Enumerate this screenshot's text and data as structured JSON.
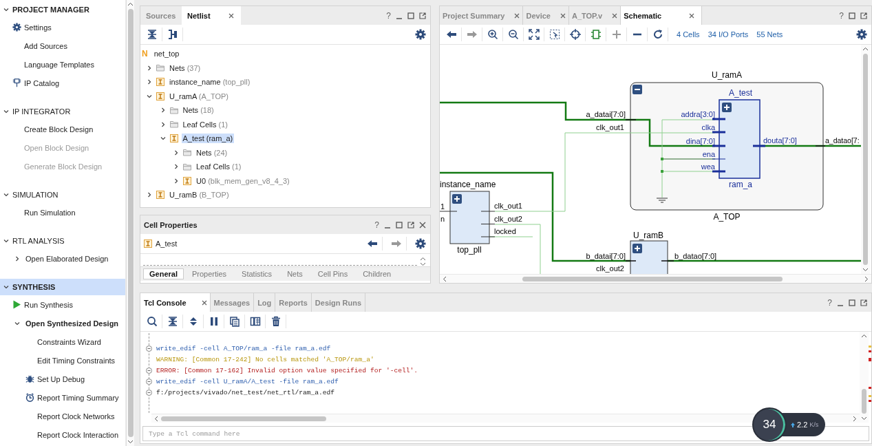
{
  "flow_navigator": {
    "sections": [
      {
        "title": "PROJECT MANAGER",
        "expanded": true,
        "selected": false,
        "active": true,
        "items": [
          {
            "label": "Settings",
            "kind": "settings",
            "disabled": false
          },
          {
            "label": "Add Sources",
            "kind": "plain",
            "disabled": false
          },
          {
            "label": "Language Templates",
            "kind": "plain",
            "disabled": false
          },
          {
            "label": "IP Catalog",
            "kind": "ip",
            "disabled": false
          }
        ]
      },
      {
        "title": "IP INTEGRATOR",
        "expanded": true,
        "selected": false,
        "active": false,
        "items": [
          {
            "label": "Create Block Design",
            "kind": "plain",
            "disabled": false
          },
          {
            "label": "Open Block Design",
            "kind": "plain",
            "disabled": true
          },
          {
            "label": "Generate Block Design",
            "kind": "plain",
            "disabled": true
          }
        ]
      },
      {
        "title": "SIMULATION",
        "expanded": true,
        "selected": false,
        "active": false,
        "items": [
          {
            "label": "Run Simulation",
            "kind": "plain",
            "disabled": false
          }
        ]
      },
      {
        "title": "RTL ANALYSIS",
        "expanded": true,
        "selected": false,
        "active": false,
        "items": [
          {
            "label": "Open Elaborated Design",
            "kind": "group",
            "disabled": false,
            "expanded": false,
            "active": false
          }
        ]
      },
      {
        "title": "SYNTHESIS",
        "expanded": true,
        "selected": true,
        "active": true,
        "items": [
          {
            "label": "Run Synthesis",
            "kind": "run",
            "disabled": false
          },
          {
            "label": "Open Synthesized Design",
            "kind": "group",
            "disabled": false,
            "expanded": true,
            "active": true,
            "children": [
              {
                "label": "Constraints Wizard",
                "kind": "plain",
                "disabled": false
              },
              {
                "label": "Edit Timing Constraints",
                "kind": "plain",
                "disabled": false
              },
              {
                "label": "Set Up Debug",
                "kind": "debug",
                "disabled": false
              },
              {
                "label": "Report Timing Summary",
                "kind": "timing",
                "disabled": false
              },
              {
                "label": "Report Clock Networks",
                "kind": "plain",
                "disabled": false
              },
              {
                "label": "Report Clock Interaction",
                "kind": "plain",
                "disabled": false
              }
            ]
          }
        ]
      }
    ]
  },
  "netlist_panel": {
    "tabs": [
      {
        "label": "Sources",
        "selected": false,
        "closable": false
      },
      {
        "label": "Netlist",
        "selected": true,
        "closable": true
      }
    ],
    "help": "?",
    "tree": {
      "label": "net_top",
      "badge": "N",
      "children": [
        {
          "label": "Nets",
          "detail": "(37)",
          "kind": "folder",
          "expanded": false,
          "selected": false
        },
        {
          "label": "instance_name",
          "detail": "(top_pll)",
          "kind": "instance",
          "expanded": false,
          "selected": false
        },
        {
          "label": "U_ramA",
          "detail": "(A_TOP)",
          "kind": "instance",
          "expanded": true,
          "selected": false,
          "children": [
            {
              "label": "Nets",
              "detail": "(18)",
              "kind": "folder",
              "expanded": false,
              "selected": false
            },
            {
              "label": "Leaf Cells",
              "detail": "(1)",
              "kind": "folder",
              "expanded": false,
              "selected": false
            },
            {
              "label": "A_test",
              "detail": "(ram_a)",
              "kind": "instance",
              "expanded": true,
              "selected": true,
              "children": [
                {
                  "label": "Nets",
                  "detail": "(24)",
                  "kind": "folder",
                  "expanded": false,
                  "selected": false
                },
                {
                  "label": "Leaf Cells",
                  "detail": "(1)",
                  "kind": "folder",
                  "expanded": false,
                  "selected": false
                },
                {
                  "label": "U0",
                  "detail": "(blk_mem_gen_v8_4_3)",
                  "kind": "instance",
                  "expanded": false,
                  "selected": false
                }
              ]
            }
          ]
        },
        {
          "label": "U_ramB",
          "detail": "(B_TOP)",
          "kind": "instance",
          "expanded": false,
          "selected": false
        }
      ]
    }
  },
  "cell_properties": {
    "title": "Cell Properties",
    "help": "?",
    "object": "A_test",
    "nav": [
      {
        "kind": "back",
        "disabled": false
      },
      {
        "kind": "forward",
        "disabled": true
      }
    ],
    "tabs": [
      {
        "label": "General",
        "selected": true
      },
      {
        "label": "Properties",
        "selected": false
      },
      {
        "label": "Statistics",
        "selected": false
      },
      {
        "label": "Nets",
        "selected": false
      },
      {
        "label": "Cell Pins",
        "selected": false
      },
      {
        "label": "Children",
        "selected": false
      }
    ]
  },
  "editor": {
    "tabs": [
      {
        "label": "Project Summary",
        "selected": false
      },
      {
        "label": "Device",
        "selected": false
      },
      {
        "label": "A_TOP.v",
        "selected": false
      },
      {
        "label": "Schematic",
        "selected": true
      }
    ],
    "help": "?",
    "tools": [
      {
        "kind": "back",
        "disabled": false
      },
      {
        "kind": "forward",
        "disabled": true
      },
      {
        "kind": "zoom_in",
        "disabled": false
      },
      {
        "kind": "zoom_out",
        "disabled": false
      },
      {
        "kind": "fit",
        "disabled": false
      },
      {
        "kind": "zoom_area",
        "disabled": false
      },
      {
        "kind": "center",
        "disabled": false
      },
      {
        "kind": "cell",
        "disabled": false
      },
      {
        "kind": "expand",
        "disabled": true
      },
      {
        "kind": "collapse",
        "disabled": false
      },
      {
        "kind": "refresh",
        "disabled": false
      }
    ],
    "stats": [
      "4 Cells",
      "34 I/O Ports",
      "55 Nets"
    ]
  },
  "schematic": {
    "hier_cell": {
      "name": "U_ramA",
      "module": "A_TOP",
      "expanded": true,
      "ports_in": [
        "a_datai[7:0]",
        "clk_out1"
      ],
      "ports_out": [
        "a_datao[7:"
      ],
      "inner": {
        "name": "A_test",
        "module": "ram_a",
        "expanded": false,
        "inputs": [
          "addra[3:0]",
          "clka",
          "dina[7:0]",
          "ena",
          "wea"
        ],
        "outputs": [
          "douta[7:0]"
        ]
      }
    },
    "pll": {
      "name": "instance_name",
      "module": "top_pll",
      "expanded": false,
      "inputs": [
        "1",
        "n"
      ],
      "outputs": [
        "clk_out1",
        "clk_out2",
        "locked"
      ]
    },
    "ram_b": {
      "name": "U_ramB",
      "expanded": false,
      "ports_in": [
        "b_datai[7:0]",
        "clk_out2"
      ],
      "ports_out": [
        "b_datao[7:0]"
      ]
    }
  },
  "console": {
    "tabs": [
      {
        "label": "Tcl Console",
        "selected": true,
        "closable": true
      },
      {
        "label": "Messages",
        "selected": false,
        "closable": false
      },
      {
        "label": "Log",
        "selected": false,
        "closable": false
      },
      {
        "label": "Reports",
        "selected": false,
        "closable": false
      },
      {
        "label": "Design Runs",
        "selected": false,
        "closable": false
      }
    ],
    "help": "?",
    "lines": [
      {
        "kind": "command",
        "fold": true,
        "text": "write_edif -cell A_TOP/ram_a -file ram_a.edf"
      },
      {
        "kind": "warning",
        "fold": false,
        "text": "WARNING: [Common 17-242] No cells matched 'A_TOP/ram_a'"
      },
      {
        "kind": "error",
        "fold": true,
        "text": "ERROR: [Common 17-162] Invalid option value specified for '-cell'."
      },
      {
        "kind": "command",
        "fold": true,
        "text": "write_edif -cell U_ramA/A_test -file ram_a.edf"
      },
      {
        "kind": "output",
        "fold": true,
        "text": "f:/projects/vivado/net_test/net_rtl/ram_a.edf"
      }
    ],
    "input": {
      "placeholder": "Type a Tcl command here"
    }
  },
  "speed_widget": {
    "percent": "34",
    "speed": "2.2",
    "unit": "K/s"
  }
}
